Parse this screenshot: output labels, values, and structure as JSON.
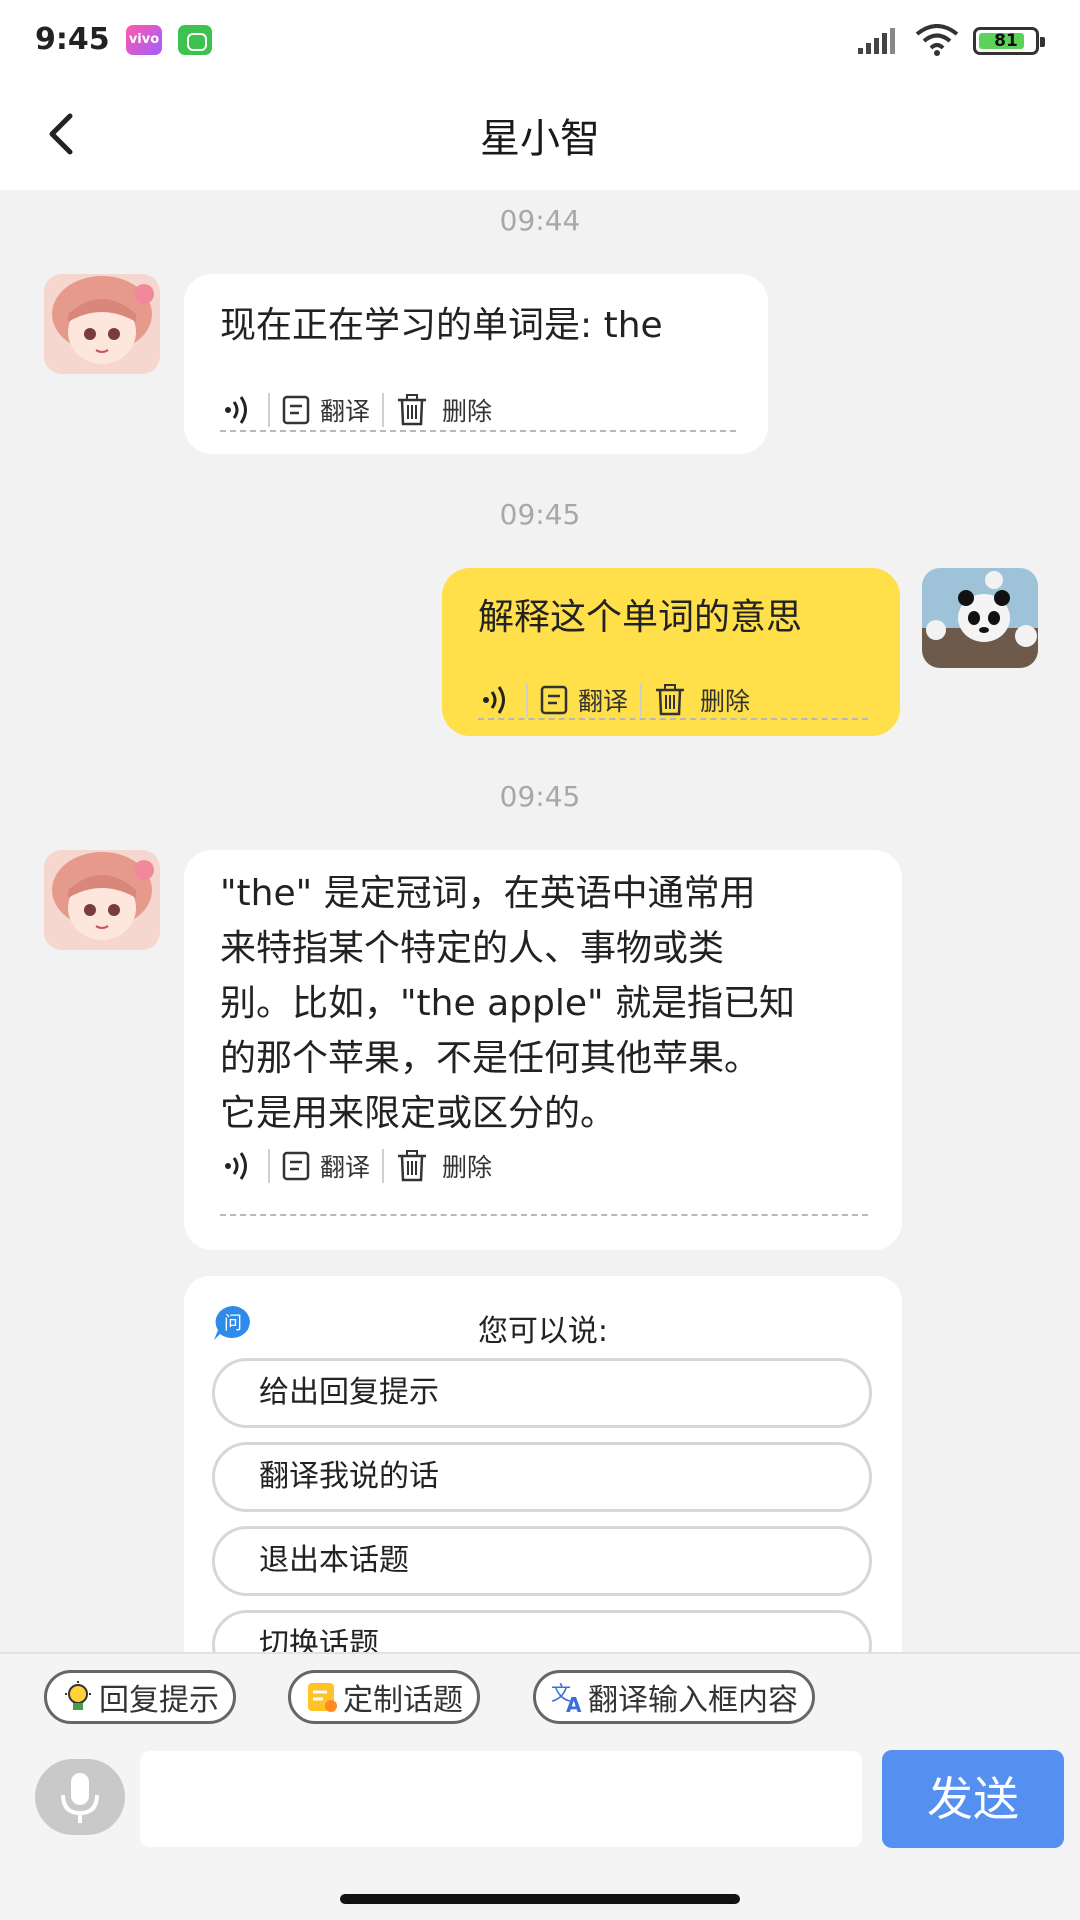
{
  "status_bar": {
    "time": "9:45",
    "app_badge_label": "vivo",
    "battery": "81",
    "icons": [
      "app-badge-icon",
      "app-badge-green-icon",
      "signal-icon",
      "wifi-icon",
      "battery-icon"
    ]
  },
  "header": {
    "title": "星小智",
    "back_icon": "chevron-left-icon"
  },
  "messages": [
    {
      "timestamp": "09:44",
      "sender": "bot",
      "text": "现在正在学习的单词是: the",
      "actions": {
        "translate": "翻译",
        "delete": "删除"
      }
    },
    {
      "timestamp": "09:45",
      "sender": "user",
      "text": "解释这个单词的意思",
      "actions": {
        "translate": "翻译",
        "delete": "删除"
      }
    },
    {
      "timestamp": "09:45",
      "sender": "bot",
      "lines": [
        "\"the\" 是定冠词，在英语中通常用",
        "来特指某个特定的人、事物或类",
        "别。比如，\"the apple\" 就是指已知",
        "的那个苹果，不是任何其他苹果。",
        "它是用来限定或区分的。"
      ],
      "actions": {
        "translate": "翻译",
        "delete": "删除"
      }
    }
  ],
  "suggestions": {
    "title": "您可以说:",
    "badge": "问",
    "items": [
      "给出回复提示",
      "翻译我说的话",
      "退出本话题",
      "切换话题"
    ]
  },
  "toolbar": {
    "reply_hint": "回复提示",
    "custom_topic": "定制话题",
    "translate_input": "翻译输入框内容",
    "send": "发送",
    "input_value": ""
  },
  "colors": {
    "user_bubble": "#ffe04a",
    "send_button": "#5590f0",
    "background": "#f2f2f2"
  }
}
